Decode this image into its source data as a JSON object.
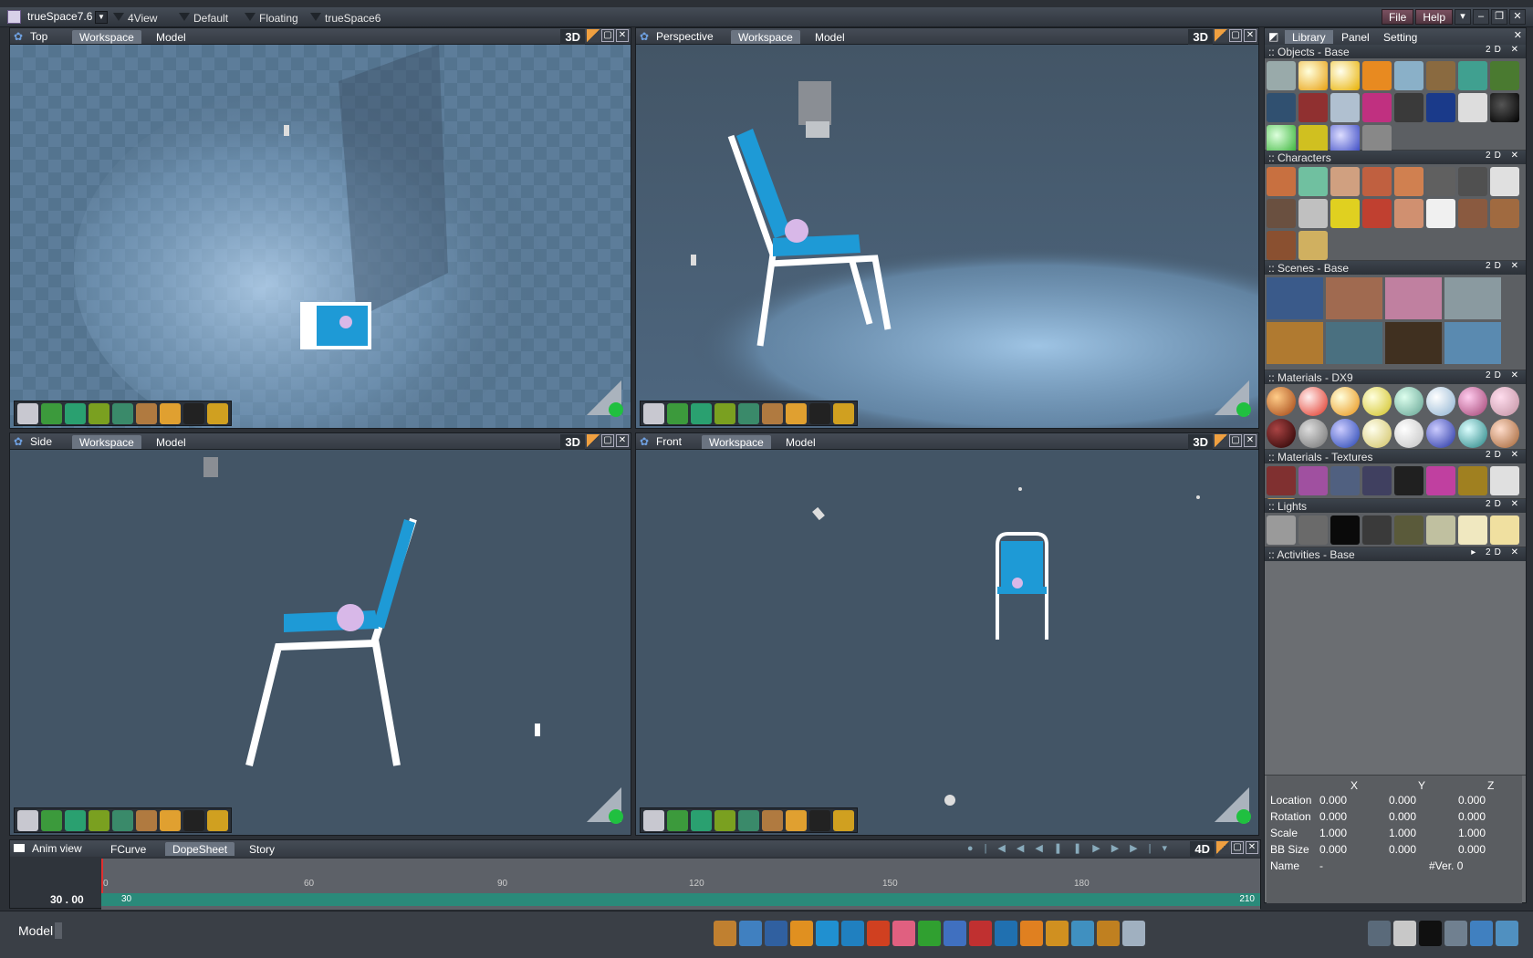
{
  "app": {
    "title": "trueSpace7.6"
  },
  "titlebar": {
    "tabs": [
      "4View",
      "Default",
      "Floating",
      "trueSpace6"
    ],
    "file": "File",
    "help": "Help"
  },
  "viewports": [
    {
      "name": "Top",
      "tab1": "Workspace",
      "tab2": "Model",
      "mode": "3D"
    },
    {
      "name": "Perspective",
      "tab1": "Workspace",
      "tab2": "Model",
      "mode": "3D"
    },
    {
      "name": "Side",
      "tab1": "Workspace",
      "tab2": "Model",
      "mode": "3D"
    },
    {
      "name": "Front",
      "tab1": "Workspace",
      "tab2": "Model",
      "mode": "3D"
    }
  ],
  "right_panel": {
    "tabs": [
      "Library",
      "Panel",
      "Setting"
    ],
    "sections": [
      {
        "title": ":: Objects - Base"
      },
      {
        "title": ":: Characters"
      },
      {
        "title": ":: Scenes - Base"
      },
      {
        "title": ":: Materials - DX9"
      },
      {
        "title": ":: Materials - Textures"
      },
      {
        "title": ":: Lights"
      },
      {
        "title": ":: Activities - Base"
      }
    ],
    "section_ctrl": "2D"
  },
  "props": {
    "headers": [
      "X",
      "Y",
      "Z"
    ],
    "rows": [
      {
        "label": "Location",
        "x": "0.000",
        "y": "0.000",
        "z": "0.000"
      },
      {
        "label": "Rotation",
        "x": "0.000",
        "y": "0.000",
        "z": "0.000"
      },
      {
        "label": "Scale",
        "x": "1.000",
        "y": "1.000",
        "z": "1.000"
      },
      {
        "label": "BB Size",
        "x": "0.000",
        "y": "0.000",
        "z": "0.000"
      }
    ],
    "name_label": "Name",
    "name_value": "-",
    "version": "#Ver. 0"
  },
  "anim": {
    "title": "Anim view",
    "tabs": [
      "FCurve",
      "DopeSheet",
      "Story"
    ],
    "mode": "4D",
    "time": "30 . 00",
    "ticks": [
      "30",
      "60",
      "90",
      "120",
      "150",
      "180"
    ],
    "start": "0",
    "end": "210",
    "frame": "30"
  },
  "status": {
    "text": "Model"
  },
  "colors": {
    "accent": "#f0a040",
    "viewport_bg": "#435566",
    "chair_blue": "#1e9ad6"
  }
}
